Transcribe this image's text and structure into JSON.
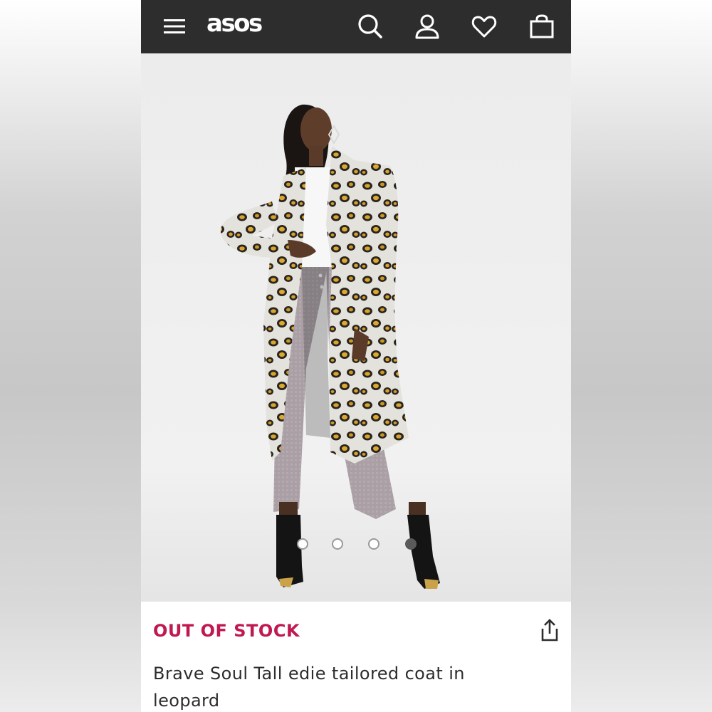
{
  "header": {
    "logo_text": "asos",
    "icons": [
      "menu-icon",
      "search-icon",
      "account-icon",
      "heart-icon",
      "bag-icon"
    ]
  },
  "gallery": {
    "image_count": 4,
    "active_index": 3
  },
  "product": {
    "status": "OUT OF STOCK",
    "title": "Brave Soul Tall edie tailored coat in leopard"
  },
  "colors": {
    "header_bg": "#2d2d2d",
    "status_red": "#c0184f",
    "text_dark": "#2d2d2d"
  }
}
